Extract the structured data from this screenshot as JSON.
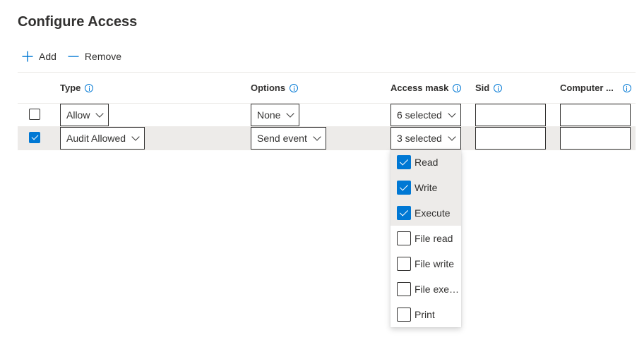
{
  "page": {
    "title": "Configure Access"
  },
  "commands": {
    "add": "Add",
    "remove": "Remove"
  },
  "columns": {
    "type": "Type",
    "options": "Options",
    "access_mask": "Access mask",
    "sid": "Sid",
    "computer": "Computer ..."
  },
  "rows": [
    {
      "checked": false,
      "type": "Allow",
      "options": "None",
      "access_mask": "6 selected",
      "sid": "",
      "computer": ""
    },
    {
      "checked": true,
      "type": "Audit Allowed",
      "options": "Send event",
      "access_mask": "3 selected",
      "sid": "",
      "computer": ""
    }
  ],
  "access_mask_menu": [
    {
      "label": "Read",
      "checked": true
    },
    {
      "label": "Write",
      "checked": true
    },
    {
      "label": "Execute",
      "checked": true
    },
    {
      "label": "File read",
      "checked": false
    },
    {
      "label": "File write",
      "checked": false
    },
    {
      "label": "File execu...",
      "checked": false
    },
    {
      "label": "Print",
      "checked": false
    }
  ],
  "colors": {
    "accent": "#0078d4",
    "selected_row": "#edebe9",
    "text": "#323130"
  }
}
